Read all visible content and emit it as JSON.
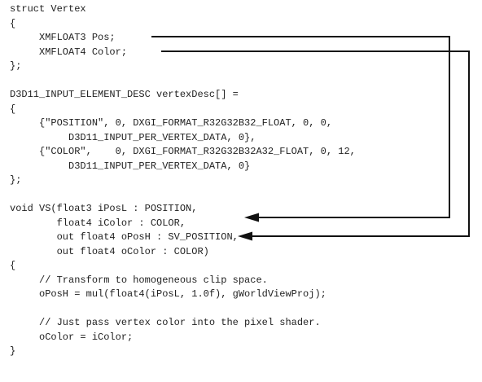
{
  "code_lines": [
    "struct Vertex",
    "{",
    "     XMFLOAT3 Pos;",
    "     XMFLOAT4 Color;",
    "};",
    "",
    "D3D11_INPUT_ELEMENT_DESC vertexDesc[] =",
    "{",
    "     {\"POSITION\", 0, DXGI_FORMAT_R32G32B32_FLOAT, 0, 0,",
    "          D3D11_INPUT_PER_VERTEX_DATA, 0},",
    "     {\"COLOR\",    0, DXGI_FORMAT_R32G32B32A32_FLOAT, 0, 12,",
    "          D3D11_INPUT_PER_VERTEX_DATA, 0}",
    "};",
    "",
    "void VS(float3 iPosL : POSITION,",
    "        float4 iColor : COLOR,",
    "        out float4 oPosH : SV_POSITION,",
    "        out float4 oColor : COLOR)",
    "{",
    "     // Transform to homogeneous clip space.",
    "     oPosH = mul(float4(iPosL, 1.0f), gWorldViewProj);",
    "",
    "     // Just pass vertex color into the pixel shader.",
    "     oColor = iColor;",
    "}"
  ],
  "connectors": [
    {
      "from": "XMFLOAT3 Pos",
      "to": "float3 iPosL : POSITION"
    },
    {
      "from": "XMFLOAT4 Color",
      "to": "float4 iColor : COLOR"
    }
  ],
  "colors": {
    "text": "#222222",
    "arrow": "#111111",
    "background": "#ffffff"
  }
}
